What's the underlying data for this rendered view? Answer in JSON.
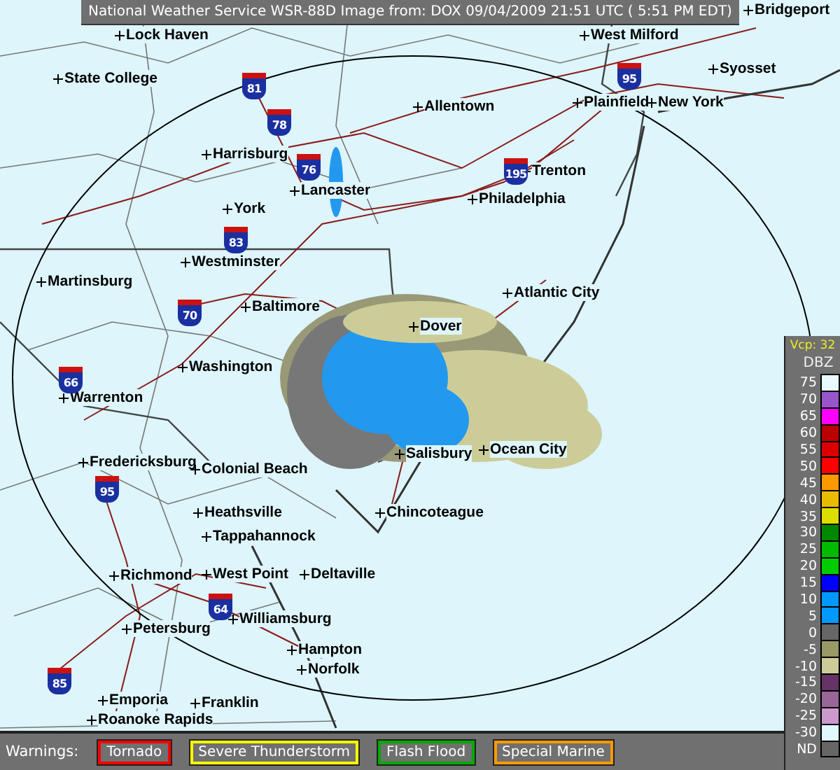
{
  "title": "National Weather Service WSR-88D Image from: DOX 09/04/2009 21:51 UTC ( 5:51 PM EDT)",
  "cities": [
    "Lock Haven",
    "West Milford",
    "Bridgeport",
    "State College",
    "Syosset",
    "Allentown",
    "Plainfield",
    "New York",
    "Harrisburg",
    "Trenton",
    "Lancaster",
    "Philadelphia",
    "York",
    "Westminster",
    "Martinsburg",
    "Baltimore",
    "Atlantic City",
    "Dover",
    "Washington",
    "Warrenton",
    "Fredericksburg",
    "Colonial Beach",
    "Salisbury",
    "Ocean City",
    "Heathsville",
    "Chincoteague",
    "Tappahannock",
    "Richmond",
    "West Point",
    "Deltaville",
    "Williamsburg",
    "Petersburg",
    "Hampton",
    "Norfolk",
    "Emporia",
    "Franklin",
    "Roanoke Rapids"
  ],
  "interstates": [
    "81",
    "78",
    "76",
    "195",
    "95",
    "83",
    "70",
    "66",
    "95",
    "64",
    "85"
  ],
  "legend": {
    "mode": "Vcp: 32",
    "unit": "DBZ",
    "levels": [
      {
        "label": "75",
        "color": "#e8f8ff"
      },
      {
        "label": "70",
        "color": "#9955cc"
      },
      {
        "label": "65",
        "color": "#ff00ff"
      },
      {
        "label": "60",
        "color": "#bb0000"
      },
      {
        "label": "55",
        "color": "#dd0000"
      },
      {
        "label": "50",
        "color": "#ff0000"
      },
      {
        "label": "45",
        "color": "#ff9900"
      },
      {
        "label": "40",
        "color": "#e8bb00"
      },
      {
        "label": "35",
        "color": "#dddd00"
      },
      {
        "label": "30",
        "color": "#008800"
      },
      {
        "label": "25",
        "color": "#00bb00"
      },
      {
        "label": "20",
        "color": "#00cc00"
      },
      {
        "label": "15",
        "color": "#0000ff"
      },
      {
        "label": "10",
        "color": "#0099ff"
      },
      {
        "label": "5",
        "color": "#0099ff"
      },
      {
        "label": "0",
        "color": "#666666"
      },
      {
        "label": "-5",
        "color": "#999966"
      },
      {
        "label": "-10",
        "color": "#cccc99"
      },
      {
        "label": "-15",
        "color": "#663366"
      },
      {
        "label": "-20",
        "color": "#996699"
      },
      {
        "label": "-25",
        "color": "#cc99cc"
      },
      {
        "label": "-30",
        "color": "#e0f8ff"
      },
      {
        "label": "ND",
        "color": "#666666"
      }
    ]
  },
  "warnings": {
    "label": "Warnings:",
    "items": [
      {
        "label": "Tornado",
        "color": "#ff0000"
      },
      {
        "label": "Severe Thunderstorm",
        "color": "#ffff00"
      },
      {
        "label": "Flash Flood",
        "color": "#00aa00"
      },
      {
        "label": "Special Marine",
        "color": "#ff9900"
      }
    ]
  }
}
